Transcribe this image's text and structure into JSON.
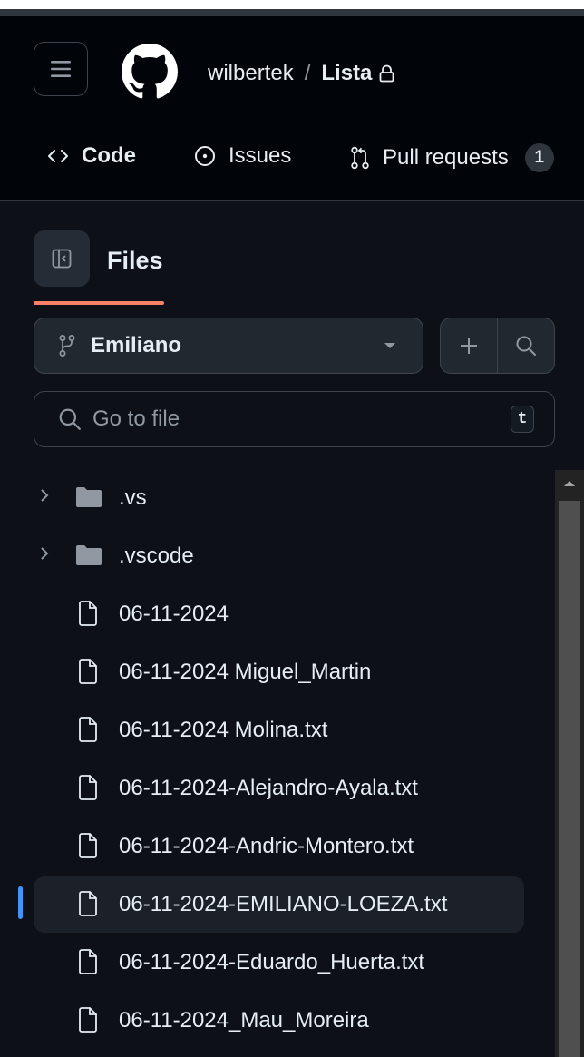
{
  "header": {
    "owner": "wilbertek",
    "separator": "/",
    "repo": "Lista"
  },
  "tabs": [
    {
      "label": "Code",
      "icon": "code-icon"
    },
    {
      "label": "Issues",
      "icon": "issue-opened-icon"
    },
    {
      "label": "Pull requests",
      "icon": "git-pull-request-icon",
      "count": "1"
    }
  ],
  "files_panel": {
    "title": "Files",
    "branch": "Emiliano",
    "search_placeholder": "Go to file",
    "shortcut_key": "t"
  },
  "tree": [
    {
      "name": ".vs",
      "type": "folder"
    },
    {
      "name": ".vscode",
      "type": "folder"
    },
    {
      "name": "06-11-2024",
      "type": "file"
    },
    {
      "name": "06-11-2024 Miguel_Martin",
      "type": "file"
    },
    {
      "name": "06-11-2024 Molina.txt",
      "type": "file"
    },
    {
      "name": "06-11-2024-Alejandro-Ayala.txt",
      "type": "file"
    },
    {
      "name": "06-11-2024-Andric-Montero.txt",
      "type": "file"
    },
    {
      "name": "06-11-2024-EMILIANO-LOEZA.txt",
      "type": "file",
      "selected": true
    },
    {
      "name": "06-11-2024-Eduardo_Huerta.txt",
      "type": "file"
    },
    {
      "name": "06-11-2024_Mau_Moreira",
      "type": "file"
    }
  ],
  "colors": {
    "background": "#0d1117",
    "header_background": "#010409",
    "accent_underline": "#f78166",
    "selection_indicator": "#4493f8",
    "folder": "#9198a1"
  }
}
